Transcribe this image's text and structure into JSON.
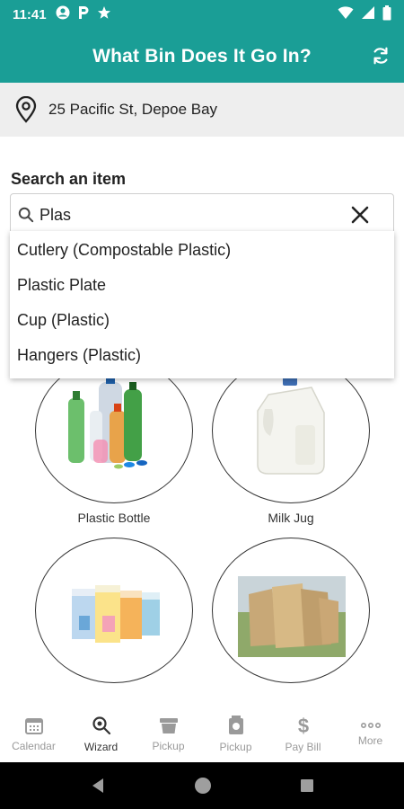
{
  "status_bar": {
    "time": "11:41"
  },
  "app_bar": {
    "title": "What Bin Does It Go In?"
  },
  "location": {
    "address": "25 Pacific St, Depoe Bay"
  },
  "search": {
    "label": "Search an item",
    "value": "Plas",
    "suggestions": [
      "Cutlery (Compostable Plastic)",
      "Plastic Plate",
      "Cup (Plastic)",
      "Hangers (Plastic)"
    ]
  },
  "items": [
    {
      "label": "Plastic Bottle"
    },
    {
      "label": "Milk Jug"
    },
    {
      "label": ""
    },
    {
      "label": ""
    }
  ],
  "bottom_nav": [
    {
      "label": "Calendar",
      "icon": "calendar-icon"
    },
    {
      "label": "Wizard",
      "icon": "magnifier-icon",
      "active": true
    },
    {
      "label": "Pickup",
      "icon": "bin-icon"
    },
    {
      "label": "Pickup",
      "icon": "trash-can-icon"
    },
    {
      "label": "Pay Bill",
      "icon": "dollar-icon"
    },
    {
      "label": "More",
      "icon": "more-icon"
    }
  ],
  "colors": {
    "primary": "#1a9e96",
    "location_bg": "#eeeeee",
    "nav_inactive": "#9a9a9a"
  }
}
